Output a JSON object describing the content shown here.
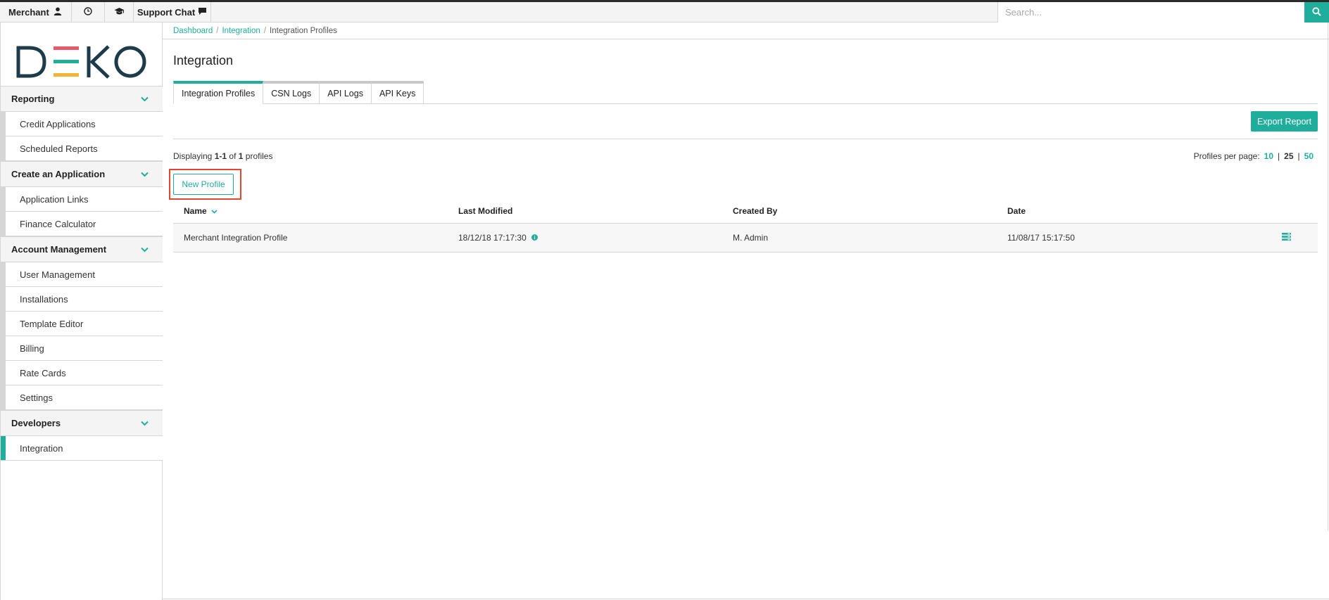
{
  "topbar": {
    "merchant_label": "Merchant",
    "support_label": "Support Chat",
    "search_placeholder": "Search...",
    "icons": [
      "user-icon",
      "clock-icon",
      "graduation-cap-icon",
      "chat-icon",
      "search-icon"
    ]
  },
  "logo": {
    "text": "DEKO",
    "colors": {
      "dark": "#1d3b4a",
      "bar_top": "#e8596b",
      "bar_mid": "#1fae9b",
      "bar_bottom": "#f1b434"
    }
  },
  "sidebar": {
    "sections": [
      {
        "title": "Reporting",
        "items": [
          "Credit Applications",
          "Scheduled Reports"
        ]
      },
      {
        "title": "Create an Application",
        "items": [
          "Application Links",
          "Finance Calculator"
        ]
      },
      {
        "title": "Account Management",
        "items": [
          "User Management",
          "Installations",
          "Template Editor",
          "Billing",
          "Rate Cards",
          "Settings"
        ]
      },
      {
        "title": "Developers",
        "items": [
          "Integration"
        ]
      }
    ],
    "active_item": "Integration"
  },
  "breadcrumb": {
    "items": [
      "Dashboard",
      "Integration"
    ],
    "current": "Integration Profiles"
  },
  "page": {
    "title": "Integration"
  },
  "tabs": [
    "Integration Profiles",
    "CSN Logs",
    "API Logs",
    "API Keys"
  ],
  "active_tab": "Integration Profiles",
  "actions": {
    "export_label": "Export Report",
    "new_profile_label": "New Profile"
  },
  "listing": {
    "displaying_prefix": "Displaying",
    "range": "1-1",
    "of_word": "of",
    "total": "1",
    "noun": "profiles",
    "per_page_label": "Profiles per page:",
    "per_page_options": [
      "10",
      "25",
      "50"
    ],
    "per_page_selected": "25"
  },
  "table": {
    "columns": [
      "Name",
      "Last Modified",
      "Created By",
      "Date"
    ],
    "rows": [
      {
        "name": "Merchant Integration Profile",
        "last_modified": "18/12/18 17:17:30",
        "created_by": "M. Admin",
        "date": "11/08/17 15:17:50"
      }
    ]
  },
  "colors": {
    "accent": "#1fae9b",
    "highlight": "#e5472a"
  }
}
